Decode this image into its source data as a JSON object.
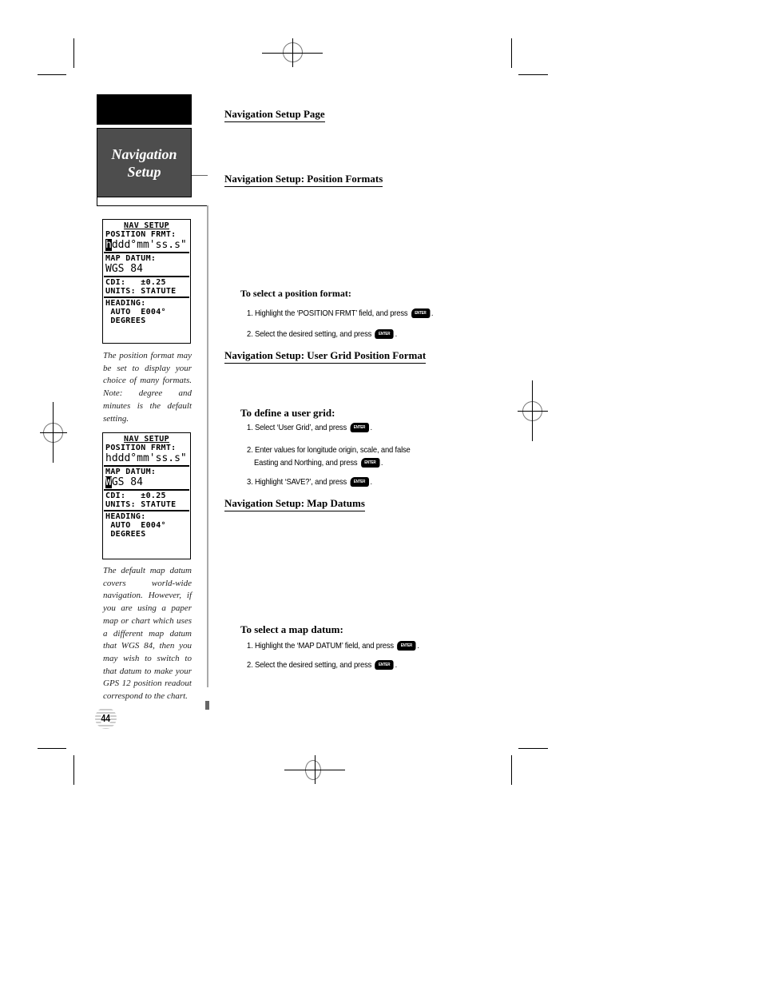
{
  "sidebar": {
    "section_title": "Navigation Setup",
    "page_number": "44"
  },
  "screens": [
    {
      "title": "NAV SETUP",
      "position_label": "POSITION FRMT:",
      "position_cursor": "h",
      "position_value": "ddd°mm'ss.s\"",
      "datum_label": "MAP DATUM:",
      "datum_cursor": "",
      "datum_value": "WGS 84",
      "cdi": "CDI:   ±0.25",
      "units": "UNITS: STATUTE",
      "heading_label": "HEADING:",
      "heading_value": " AUTO  E004°",
      "heading_unit": " DEGREES"
    },
    {
      "title": "NAV SETUP",
      "position_label": "POSITION FRMT:",
      "position_cursor": "",
      "position_value": "hddd°mm'ss.s\"",
      "datum_label": "MAP DATUM:",
      "datum_cursor": "W",
      "datum_value": "GS 84",
      "cdi": "CDI:   ±0.25",
      "units": "UNITS: STATUTE",
      "heading_label": "HEADING:",
      "heading_value": " AUTO  E004°",
      "heading_unit": " DEGREES"
    }
  ],
  "captions": [
    "The position format may be set to display your choice of many formats. Note: degree and minutes is the default setting.",
    "The default map datum covers world-wide navigation. However, if you are using a paper map or chart which uses a different map datum that WGS 84, then you may wish to switch to that datum to make your GPS 12 position readout correspond to the chart."
  ],
  "main": {
    "headings": {
      "setup_page": "Navigation Setup Page",
      "position_formats": "Navigation Setup: Position Formats",
      "user_grid": "Navigation Setup: User Grid Position Format",
      "map_datums": "Navigation Setup: Map Datums"
    },
    "enter_key_label": "ENTER",
    "select_position": {
      "title": "To select a position format:",
      "steps": [
        "1. Highlight the ‘POSITION FRMT’ field, and press",
        "2. Select the desired setting, and press"
      ]
    },
    "user_grid": {
      "title": "To define a user grid:",
      "steps": [
        "1. Select ‘User Grid’, and press",
        "2. Enter values for longitude origin, scale, and false",
        "Easting and Northing, and press",
        "3. Highlight ‘SAVE?’, and press"
      ]
    },
    "select_datum": {
      "title": "To select a map datum:",
      "steps": [
        "1. Highlight the ‘MAP DATUM’ field, and press",
        "2. Select the desired setting, and press"
      ]
    }
  }
}
